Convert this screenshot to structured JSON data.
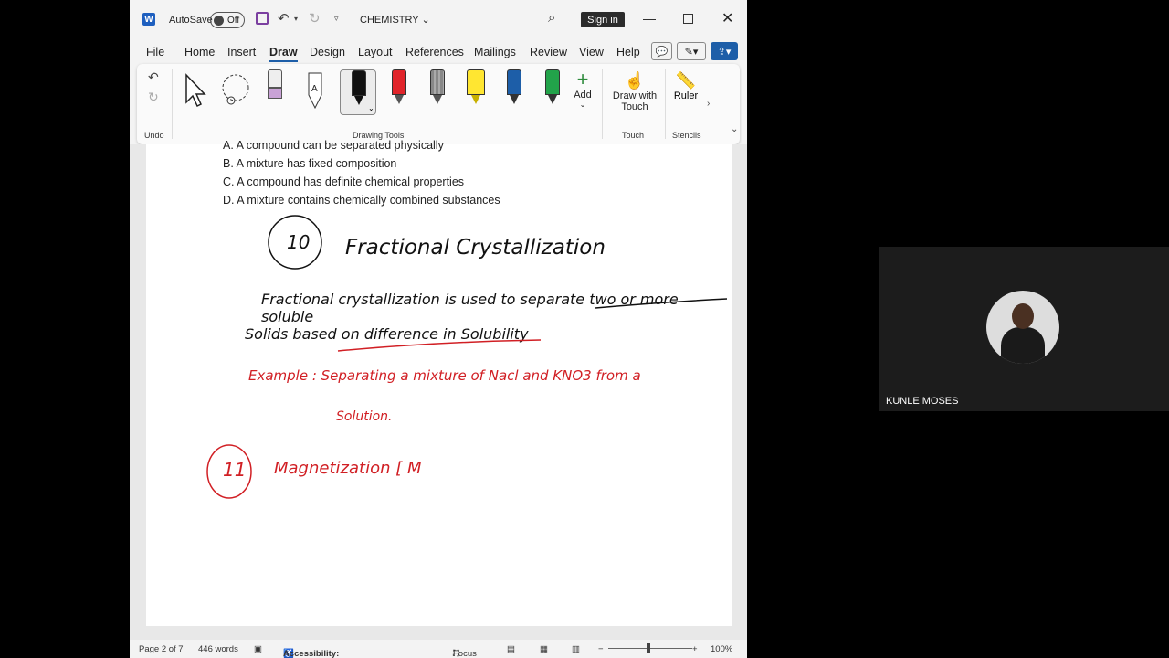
{
  "titlebar": {
    "app_logo": "W",
    "autosave_label": "AutoSave",
    "autosave_state": "Off",
    "doc_title": "CHEMISTRY",
    "signin_label": "Sign in"
  },
  "menu": {
    "tabs": [
      "File",
      "Home",
      "Insert",
      "Draw",
      "Design",
      "Layout",
      "References",
      "Mailings",
      "Review",
      "View",
      "Help"
    ],
    "active_tab": "Draw"
  },
  "ribbon": {
    "undo_group_label": "Undo",
    "drawing_tools_label": "Drawing Tools",
    "pens": [
      {
        "name": "eraser",
        "color": "#c9a2d6"
      },
      {
        "name": "action-pen",
        "color": "#ffffff"
      },
      {
        "name": "black-pen",
        "color": "#111111"
      },
      {
        "name": "red-pen",
        "color": "#e0242a"
      },
      {
        "name": "gray-pencil",
        "color": "#8a8a8a"
      },
      {
        "name": "yellow-highlighter",
        "color": "#ffe631"
      },
      {
        "name": "blue-pen",
        "color": "#1d5ea8"
      },
      {
        "name": "green-pen",
        "color": "#22a34a"
      }
    ],
    "add_label": "Add",
    "draw_with_touch_label": "Draw with Touch",
    "touch_group_label": "Touch",
    "ruler_label": "Ruler",
    "stencils_group_label": "Stencils"
  },
  "document": {
    "options": [
      "A. A compound can be separated physically",
      "B. A mixture has fixed composition",
      "C. A compound has definite chemical properties",
      "D. A mixture contains chemically combined substances"
    ],
    "ink": {
      "number_10": "10",
      "heading_10": "Fractional Crystallization",
      "line1": "Fractional crystallization is used to separate two or more soluble",
      "line2": "Solids based on difference in Solubility",
      "example": "Example : Separating a mixture of Nacl and KNO3 from a",
      "example_cont": "Solution.",
      "number_11": "11",
      "heading_11": "Magnetization [ M"
    },
    "ink_colors": {
      "black": "#111111",
      "red": "#d11f24"
    }
  },
  "statusbar": {
    "page": "Page 2 of 7",
    "words": "446 words",
    "accessibility": "Accessibility: Good to go",
    "focus": "Focus",
    "zoom": "100%"
  },
  "video": {
    "participant_name": "KUNLE MOSES"
  }
}
